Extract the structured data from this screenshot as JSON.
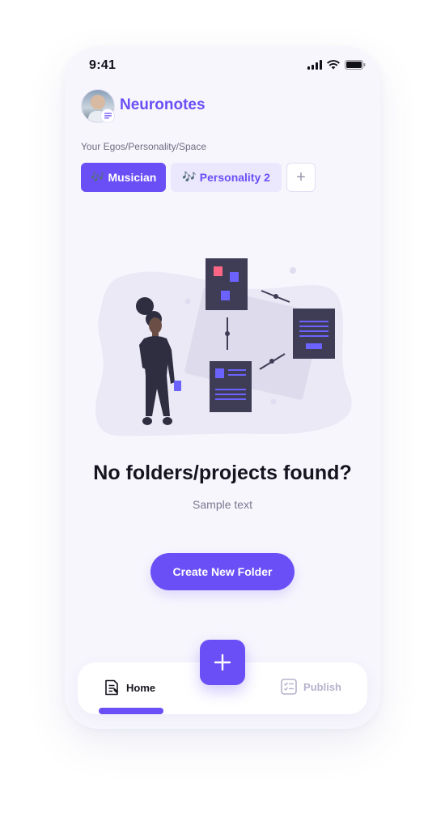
{
  "status_bar": {
    "time": "9:41",
    "icons": [
      "signal-icon",
      "wifi-icon",
      "battery-icon"
    ]
  },
  "header": {
    "app_title": "Neuronotes",
    "avatar_badge_icon": "note-lines-icon"
  },
  "egos": {
    "label": "Your Egos/Personality/Space",
    "chips": [
      {
        "icon": "🎶",
        "label": "Musician",
        "active": true
      },
      {
        "icon": "🎶",
        "label": "Personality 2",
        "active": false
      }
    ],
    "add_icon": "+"
  },
  "empty_state": {
    "title": "No folders/projects found?",
    "subtitle": "Sample text",
    "button_label": "Create New Folder"
  },
  "bottom_nav": {
    "home_label": "Home",
    "publish_label": "Publish",
    "fab_icon": "+"
  },
  "colors": {
    "accent": "#6b4ff6",
    "accent_soft": "#ebe7fd",
    "background": "#f7f6fd",
    "text_dark": "#15141f",
    "text_muted": "#7a7890"
  }
}
